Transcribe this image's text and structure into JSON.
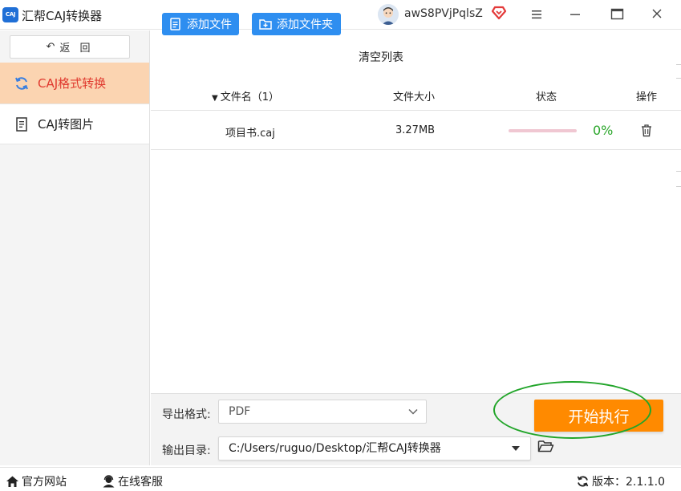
{
  "app": {
    "title": "汇帮CAJ转换器",
    "logo_text": "CAJ",
    "user_name": "awS8PVjPqlsZ"
  },
  "colors": {
    "accent_blue": "#2e8ef0",
    "active_nav_bg": "#fbd4b1",
    "active_nav_text": "#e0392e",
    "start_orange": "#ff8a00",
    "progress_green": "#2aa62a",
    "highlight_green": "#22a52a"
  },
  "icons": {
    "vip": "heart-diamond-icon",
    "menu": "hamburger-icon",
    "minimize": "minimize-icon",
    "maximize": "maximize-icon",
    "close": "close-icon",
    "back": "undo-arrow-icon",
    "convert": "refresh-icon",
    "doc": "document-icon",
    "add_file": "file-add-icon",
    "add_folder": "folder-add-icon",
    "delete": "trash-icon",
    "browse": "folder-open-icon",
    "home": "home-icon",
    "service": "support-agent-icon",
    "update": "sync-icon"
  },
  "sidebar": {
    "back_label": "返 回",
    "items": [
      {
        "label": "CAJ格式转换",
        "active": true
      },
      {
        "label": "CAJ转图片",
        "active": false
      }
    ]
  },
  "toolbar": {
    "add_file": "添加文件",
    "add_folder": "添加文件夹",
    "clear_list": "清空列表"
  },
  "table": {
    "headers": {
      "filename": "文件名（1）",
      "size": "文件大小",
      "status": "状态",
      "action": "操作"
    },
    "rows": [
      {
        "name": "项目书.caj",
        "size": "3.27MB",
        "progress": 0,
        "percent": "0%"
      }
    ]
  },
  "bottom": {
    "format_label": "导出格式:",
    "format_value": "PDF",
    "dir_label": "输出目录:",
    "dir_value": "C:/Users/ruguo/Desktop/汇帮CAJ转换器",
    "start_label": "开始执行"
  },
  "statusbar": {
    "website": "官方网站",
    "service": "在线客服",
    "version": "版本：2.1.1.0"
  }
}
